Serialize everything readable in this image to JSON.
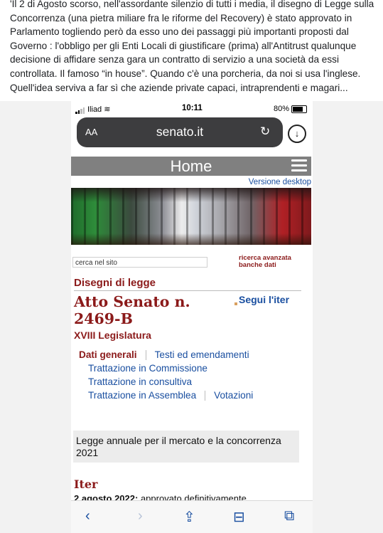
{
  "post": {
    "paragraph": "'Il 2 di Agosto scorso, nell'assordante silenzio di tutti i media, il disegno di Legge sulla Concorrenza (una pietra miliare fra le riforme del Recovery) è stato approvato in Parlamento togliendo però da esso uno dei passaggi più importanti proposti dal Governo : l'obbligo per gli Enti Locali di giustificare (prima) all'Antitrust qualunque decisione di affidare senza gara un contratto di servizio a una società da essi controllata. Il famoso “in house”. Quando c'è una porcheria, da noi si usa l'inglese. Quell'idea serviva a far sì che aziende private capaci, intraprendenti e magari..."
  },
  "status_bar": {
    "carrier": "Iliad",
    "time": "10:11",
    "battery": "80%"
  },
  "browser": {
    "text_size": "AA",
    "url": "senato.it"
  },
  "site": {
    "home_title": "Home",
    "desktop_link": "Versione desktop",
    "search_placeholder": "cerca nel sito",
    "advanced_search": "ricerca avanzata",
    "databases": "banche dati",
    "section_title": "Disegni di legge",
    "atto_title": "Atto Senato n. 2469-B",
    "segui_iter": "Segui l'iter",
    "legislatura": "XVIII Legislatura",
    "tabs": {
      "dati_generali": "Dati generali",
      "testi": "Testi ed emendamenti",
      "commissione": "Trattazione in Commissione",
      "consultiva": "Trattazione in consultiva",
      "assemblea": "Trattazione in Assemblea",
      "votazioni": "Votazioni"
    },
    "summary": "Legge annuale per il mercato e la concorrenza 2021",
    "iter_title": "Iter",
    "iter_date": "2 agosto 2022:",
    "iter_text": "approvato definitivamente"
  },
  "toolbar_icons": [
    "back-arrow",
    "forward-arrow",
    "share",
    "bookmarks",
    "tabs"
  ]
}
